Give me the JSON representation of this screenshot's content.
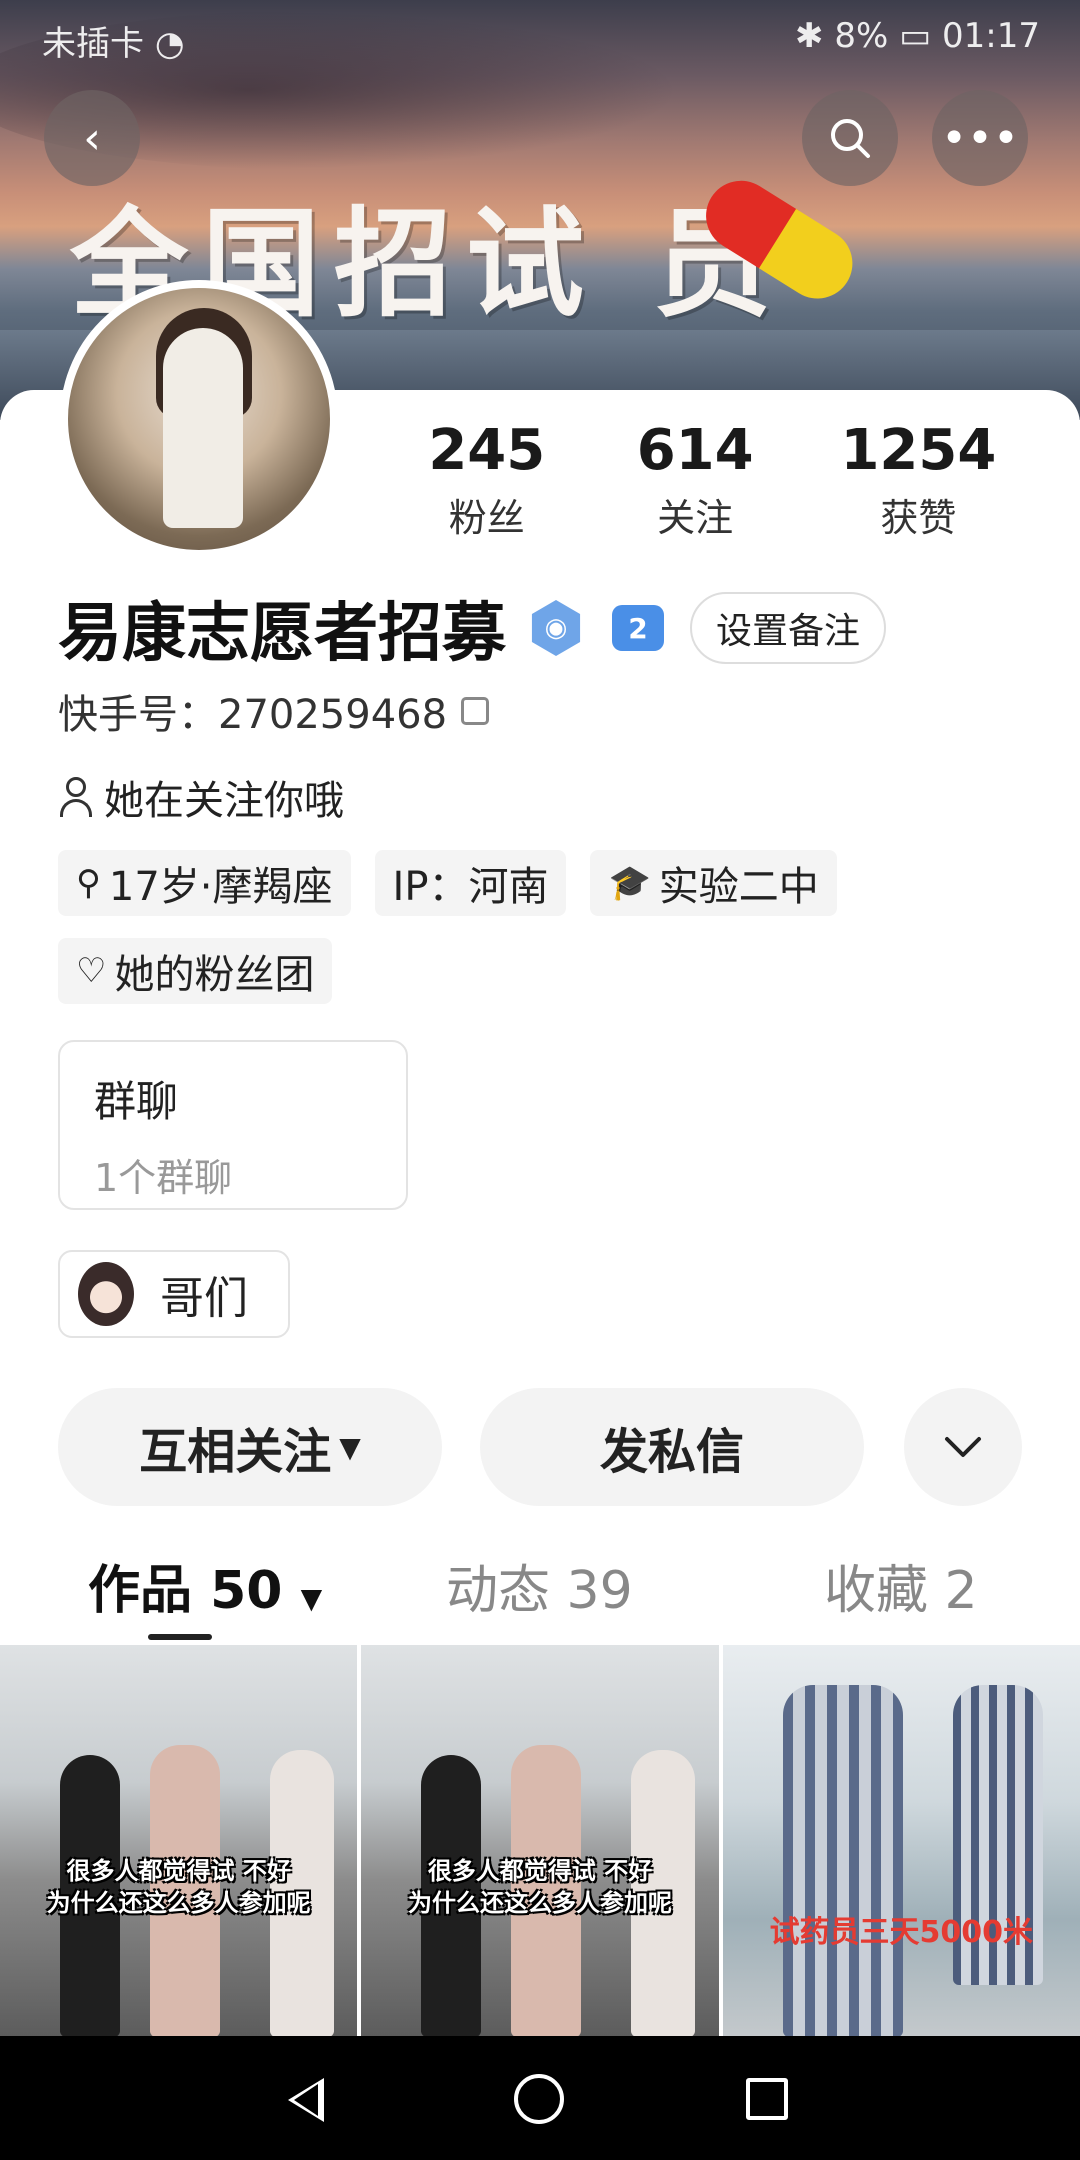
{
  "status_bar": {
    "carrier": "未插卡",
    "battery": "8%",
    "time": "01:17"
  },
  "banner": {
    "title": "全国招试  员"
  },
  "stats": [
    {
      "value": "245",
      "label": "粉丝"
    },
    {
      "value": "614",
      "label": "关注"
    },
    {
      "value": "1254",
      "label": "获赞"
    }
  ],
  "profile": {
    "name": "易康志愿者招募",
    "level": "2",
    "remark_button": "设置备注",
    "kuaishou_id": "快手号：270259468",
    "follow_note": "她在关注你哦"
  },
  "tags": [
    {
      "icon": "search-icon",
      "text": "17岁·摩羯座"
    },
    {
      "icon": "",
      "text": "IP：河南"
    },
    {
      "icon": "school-icon",
      "text": "实验二中"
    },
    {
      "icon": "heart-icon",
      "text": "她的粉丝团"
    }
  ],
  "group_chat": {
    "title": "群聊",
    "subtitle": "1个群聊"
  },
  "bros": {
    "label": "哥们"
  },
  "actions": {
    "mutual_follow": "互相关注",
    "message": "发私信"
  },
  "tabs": [
    {
      "label": "作品 50"
    },
    {
      "label": "动态 39"
    },
    {
      "label": "收藏 2"
    }
  ],
  "videos": [
    {
      "caption_line1": "很多人都觉得试 不好",
      "caption_line2": "为什么还这么多人参加呢"
    },
    {
      "caption_line1": "很多人都觉得试 不好",
      "caption_line2": "为什么还这么多人参加呢"
    },
    {
      "caption_line1": "试药员三天5000米",
      "caption_line2": ""
    }
  ],
  "colors": {
    "accent_blue": "#4a8fe7",
    "red_caption": "#e53b32",
    "pill_red": "#e12c24",
    "pill_yellow": "#f2cf1d"
  }
}
